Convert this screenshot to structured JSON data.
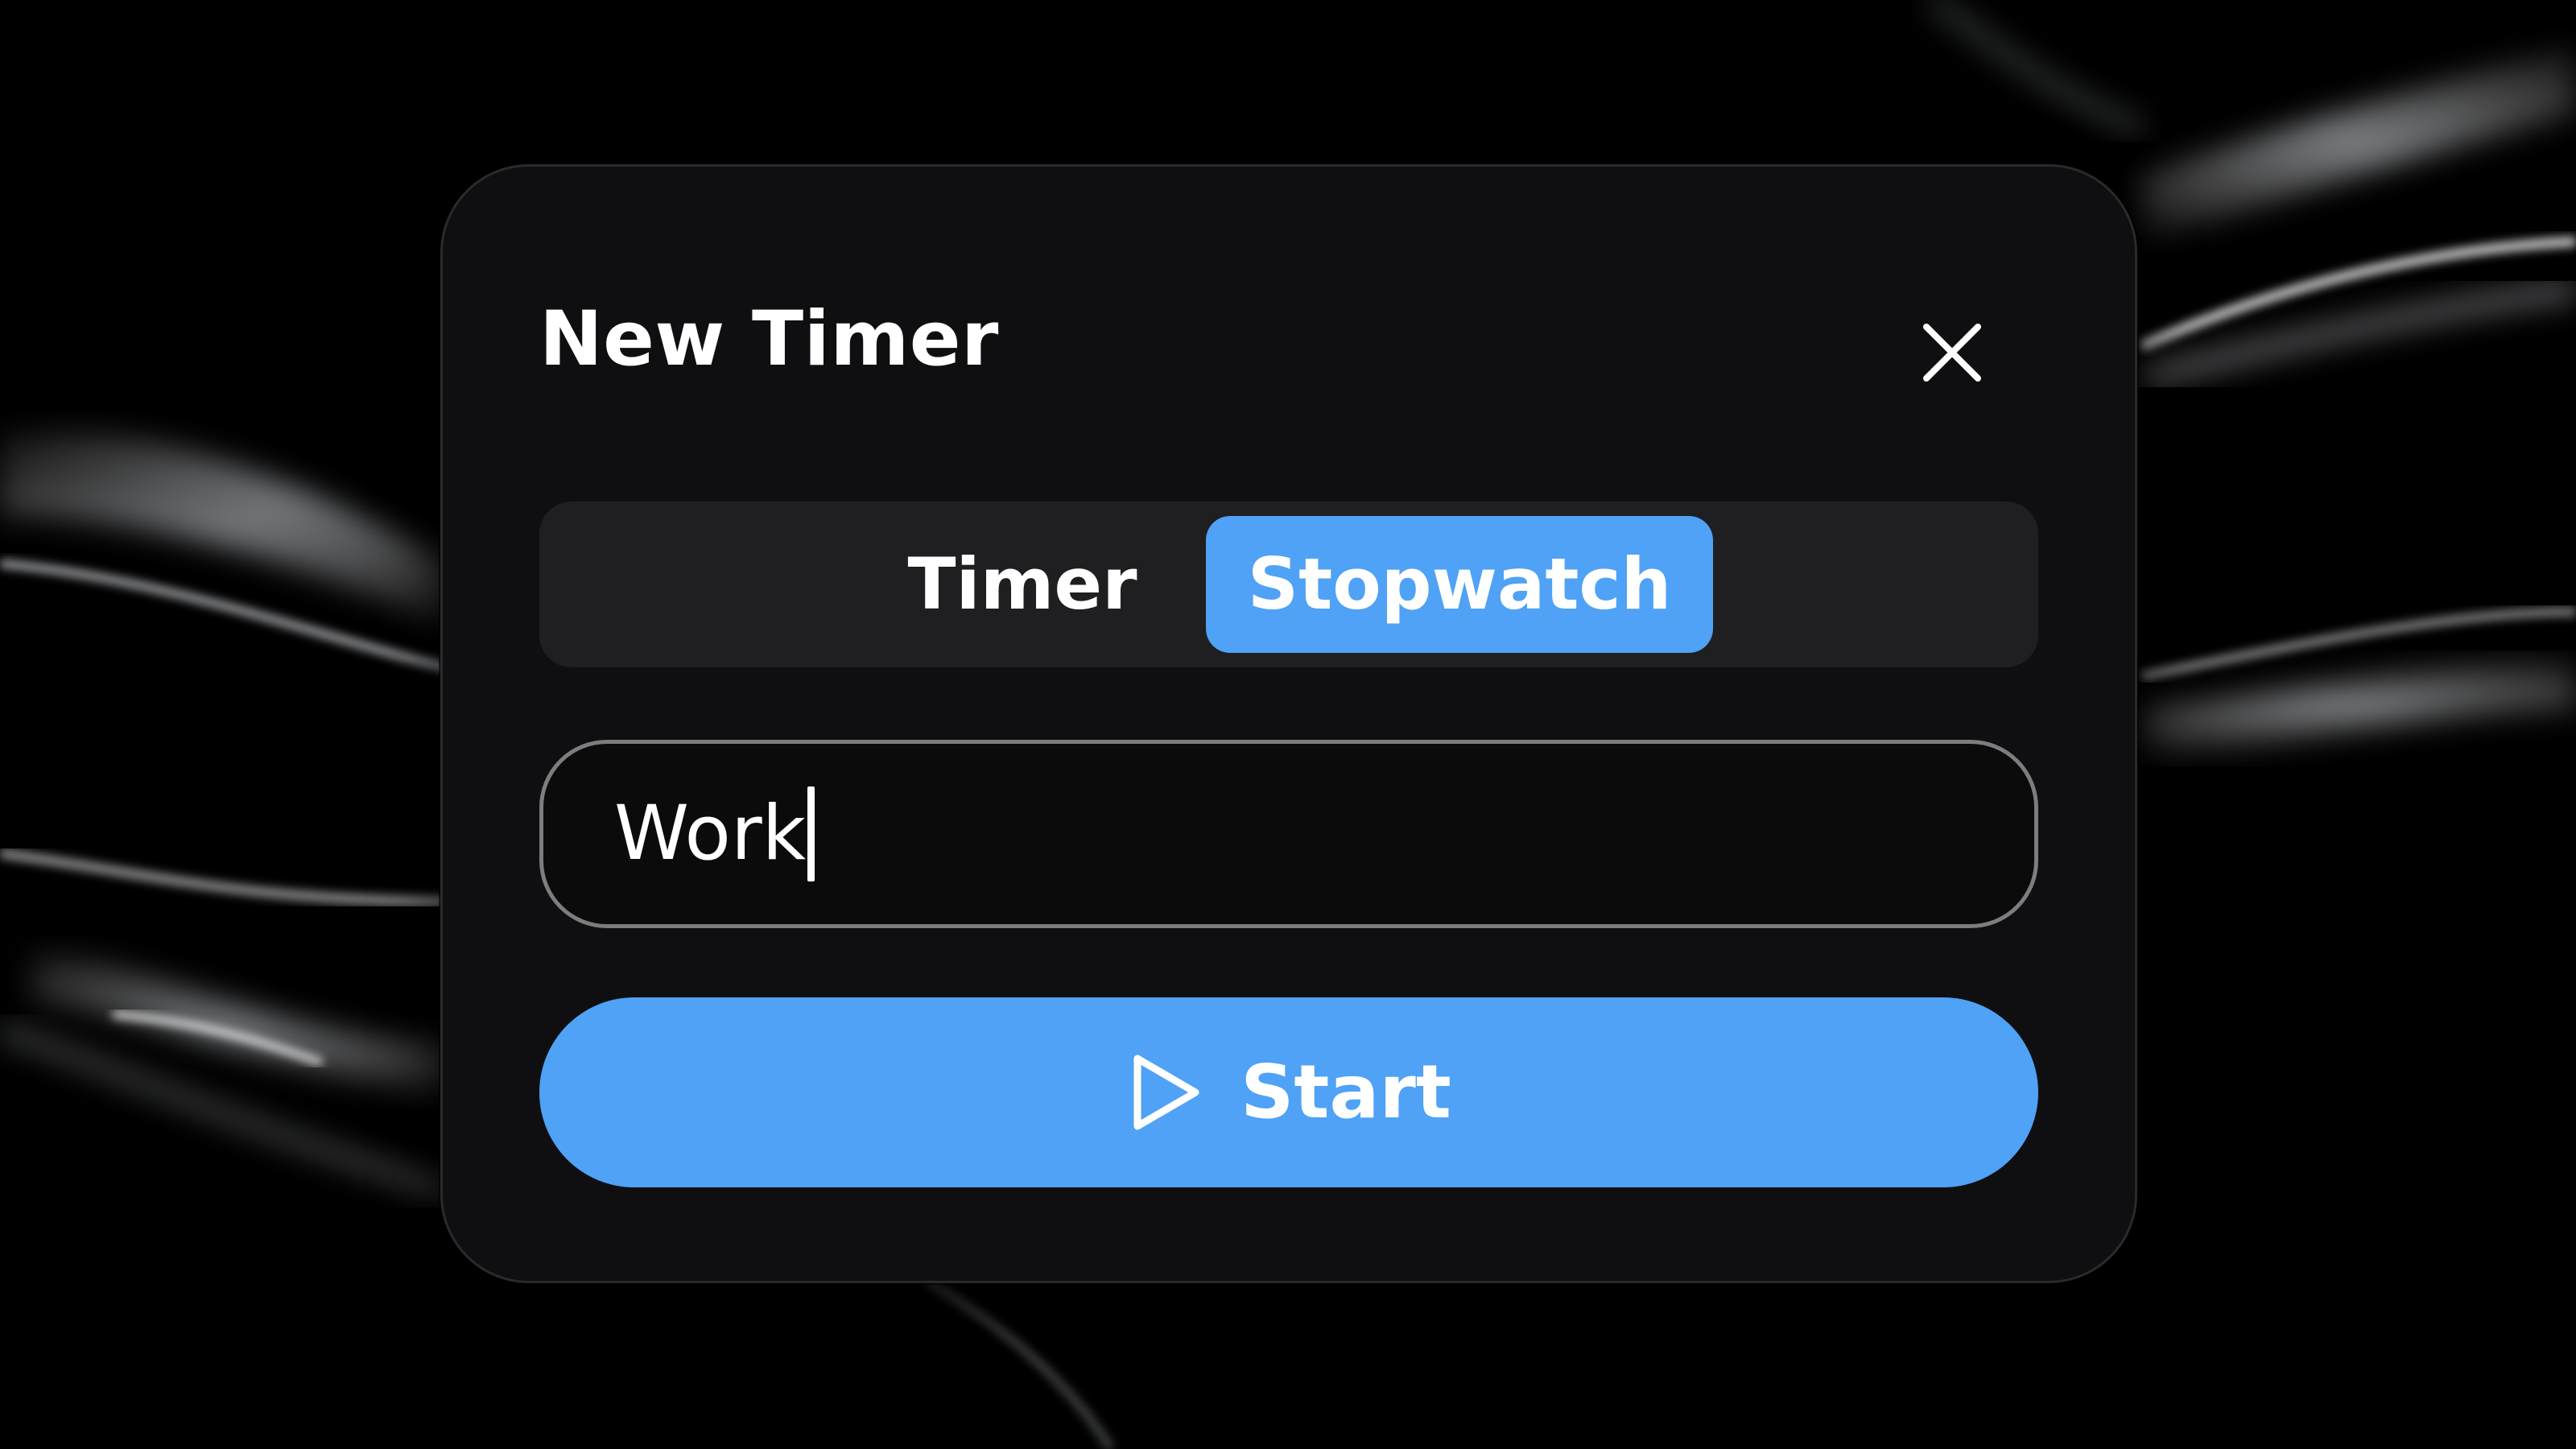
{
  "dialog": {
    "title": "New Timer",
    "close_icon": "close-icon"
  },
  "mode_toggle": {
    "options": [
      {
        "label": "Timer",
        "selected": false
      },
      {
        "label": "Stopwatch",
        "selected": true
      }
    ]
  },
  "name_field": {
    "value": "Work",
    "focused": true
  },
  "start_button": {
    "label": "Start",
    "icon": "play-icon"
  },
  "colors": {
    "accent": "#4fa2f5",
    "dialog_background": "#0f0f11",
    "segmented_background": "#1f1f22",
    "text": "#ffffff"
  }
}
